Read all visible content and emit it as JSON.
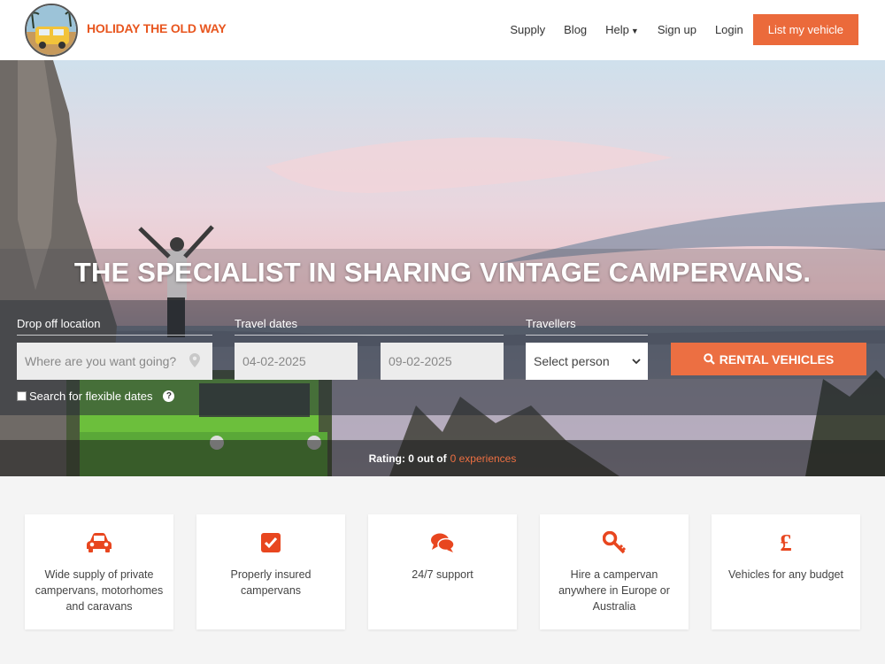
{
  "header": {
    "brand": "HOLIDAY THE OLD WAY",
    "nav": {
      "supply": "Supply",
      "blog": "Blog",
      "help": "Help",
      "signup": "Sign up",
      "login": "Login",
      "cta": "List my vehicle"
    }
  },
  "hero": {
    "headline": "THE SPECIALIST IN SHARING VINTAGE CAMPERVANS.",
    "search": {
      "location_label": "Drop off location",
      "location_placeholder": "Where are you want going?",
      "dates_label": "Travel dates",
      "date_from": "04-02-2025",
      "date_to": "09-02-2025",
      "travellers_label": "Travellers",
      "travellers_value": "Select person",
      "button": "RENTAL VEHICLES",
      "flexible_label": "Search for flexible dates",
      "help_icon": "?"
    },
    "rating": {
      "text": "Rating: 0 out of",
      "link": "0 experiences"
    }
  },
  "features": [
    {
      "icon": "car-icon",
      "text": "Wide supply of private campervans, motorhomes and caravans"
    },
    {
      "icon": "check-square-icon",
      "text": "Properly insured campervans"
    },
    {
      "icon": "comments-icon",
      "text": "24/7 support"
    },
    {
      "icon": "key-icon",
      "text": "Hire a campervan anywhere in Europe or Australia"
    },
    {
      "icon": "pound-icon",
      "text": "Vehicles for any budget",
      "glyph": "£"
    }
  ],
  "colors": {
    "accent": "#eb6a3b",
    "brand_text": "#e8561f",
    "icon": "#e8461f"
  }
}
